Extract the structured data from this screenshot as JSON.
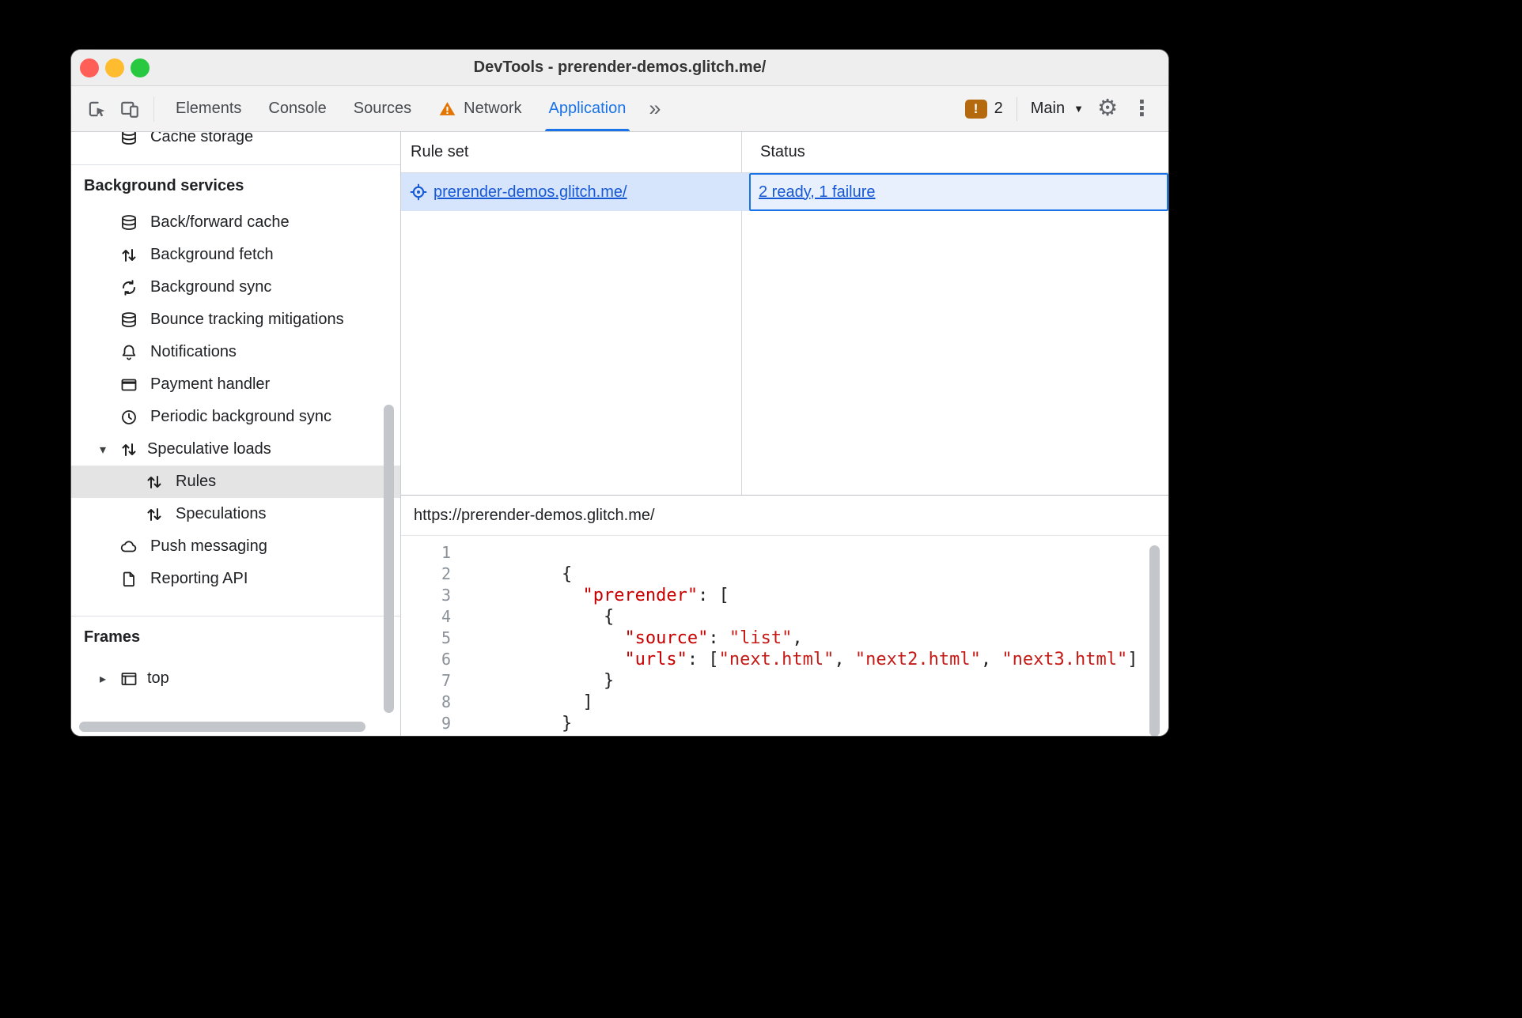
{
  "colors": {
    "accent": "#1a73e8",
    "link": "#1558d6",
    "warning": "#e37400",
    "issues_badge": "#b4690e",
    "sidebar_selected": "#e4e4e4",
    "row_selected_bg": "#d7e5fc",
    "cell_focus_bg": "#e8f0fe",
    "code_key": "#c80000",
    "code_string": "#c41a16",
    "gutter_text": "#8a9199",
    "traffic_red": "#ff5f57",
    "traffic_yellow": "#febc2e",
    "traffic_green": "#28c840"
  },
  "window": {
    "title": "DevTools - prerender-demos.glitch.me/"
  },
  "icons": {
    "more_tabs": "»",
    "caret_down": "▼",
    "gear": "⚙",
    "kebab": "⋮",
    "collapse": "▾",
    "expand": "▸",
    "bang": "!"
  },
  "toolbar": {
    "tabs": [
      "Elements",
      "Console",
      "Sources",
      "Network",
      "Application"
    ],
    "issues_count": "2",
    "context_label": "Main"
  },
  "sidebar": {
    "clipped_item": "Cache storage",
    "section_background_services": "Background services",
    "items": [
      "Back/forward cache",
      "Background fetch",
      "Background sync",
      "Bounce tracking mitigations",
      "Notifications",
      "Payment handler",
      "Periodic background sync"
    ],
    "speculative_loads": "Speculative loads",
    "speculative_children": [
      "Rules",
      "Speculations"
    ],
    "items_after": [
      "Push messaging",
      "Reporting API"
    ],
    "section_frames": "Frames",
    "frame_top": "top"
  },
  "rule_table": {
    "headers": [
      "Rule set",
      "Status"
    ],
    "row": {
      "rule_set": "prerender-demos.glitch.me/",
      "status": "2 ready, 1 failure"
    }
  },
  "preview": {
    "url": "https://prerender-demos.glitch.me/",
    "lines": [
      [],
      [
        {
          "t": "p",
          "v": "        {"
        }
      ],
      [
        {
          "t": "p",
          "v": "          "
        },
        {
          "t": "k",
          "v": "\"prerender\""
        },
        {
          "t": "p",
          "v": ": ["
        }
      ],
      [
        {
          "t": "p",
          "v": "            {"
        }
      ],
      [
        {
          "t": "p",
          "v": "              "
        },
        {
          "t": "k",
          "v": "\"source\""
        },
        {
          "t": "p",
          "v": ": "
        },
        {
          "t": "s",
          "v": "\"list\""
        },
        {
          "t": "p",
          "v": ","
        }
      ],
      [
        {
          "t": "p",
          "v": "              "
        },
        {
          "t": "k",
          "v": "\"urls\""
        },
        {
          "t": "p",
          "v": ": ["
        },
        {
          "t": "s",
          "v": "\"next.html\""
        },
        {
          "t": "p",
          "v": ", "
        },
        {
          "t": "s",
          "v": "\"next2.html\""
        },
        {
          "t": "p",
          "v": ", "
        },
        {
          "t": "s",
          "v": "\"next3.html\""
        },
        {
          "t": "p",
          "v": "]"
        }
      ],
      [
        {
          "t": "p",
          "v": "            }"
        }
      ],
      [
        {
          "t": "p",
          "v": "          ]"
        }
      ],
      [
        {
          "t": "p",
          "v": "        }"
        }
      ]
    ]
  }
}
